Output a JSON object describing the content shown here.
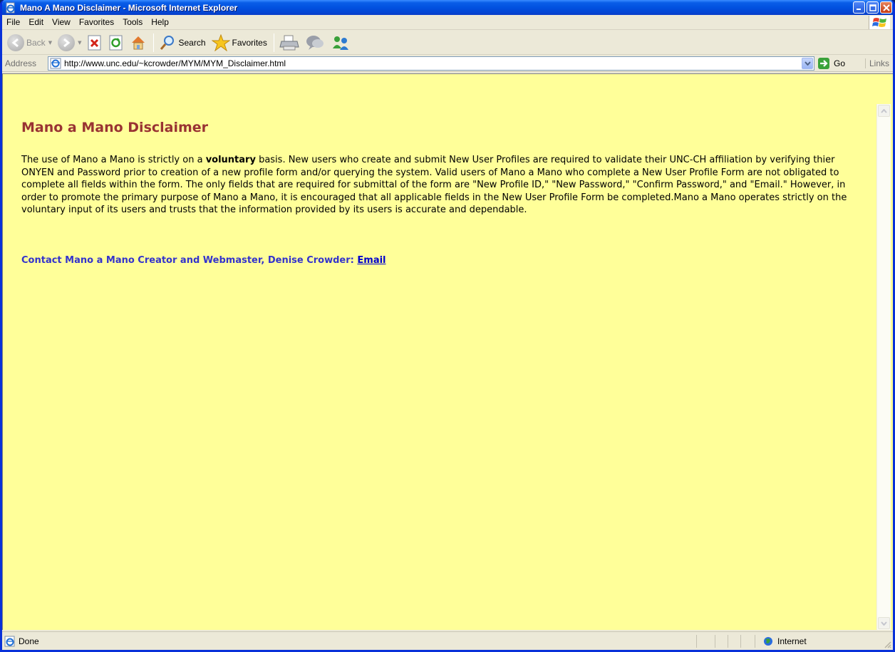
{
  "window": {
    "title": "Mano A Mano Disclaimer - Microsoft Internet Explorer"
  },
  "menu": {
    "items": [
      "File",
      "Edit",
      "View",
      "Favorites",
      "Tools",
      "Help"
    ]
  },
  "toolbar": {
    "back_label": "Back",
    "search_label": "Search",
    "favorites_label": "Favorites"
  },
  "address": {
    "label": "Address",
    "url": "http://www.unc.edu/~kcrowder/MYM/MYM_Disclaimer.html",
    "go_label": "Go",
    "links_label": "Links"
  },
  "page": {
    "title": "Mano a Mano Disclaimer",
    "body_before_bold": "The use of Mano a Mano is strictly on a ",
    "body_bold": "voluntary",
    "body_after_bold": " basis. New users who create and submit New User Profiles are required to validate their UNC-CH affiliation by verifying thier ONYEN and Password prior to creation of a new profile form and/or querying the system. Valid users of Mano a Mano who complete a New User Profile Form are not obligated to complete all fields within the form. The only fields that are required for submittal of the form are \"New Profile ID,\" \"New Password,\" \"Confirm Password,\" and \"Email.\" However, in order to promote the primary purpose of Mano a Mano, it is encouraged that all applicable fields in the New User Profile Form be completed.Mano a Mano operates strictly on the voluntary input of its users and trusts that the information provided by its users is accurate and dependable.",
    "contact_text": "Contact Mano a Mano Creator and Webmaster, Denise Crowder: ",
    "email_link": "Email"
  },
  "status": {
    "text": "Done",
    "zone": "Internet"
  },
  "colors": {
    "page_background": "#ffff99",
    "title_color": "#993333",
    "contact_color": "#3333cc",
    "link_color": "#0000cc"
  }
}
